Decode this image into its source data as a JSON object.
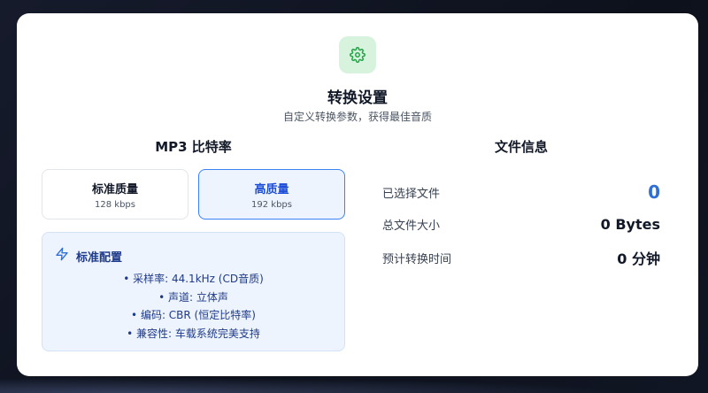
{
  "header": {
    "icon": "gear-icon",
    "title": "转换设置",
    "subtitle": "自定义转换参数，获得最佳音质"
  },
  "bitrate": {
    "heading": "MP3 比特率",
    "options": [
      {
        "label": "标准质量",
        "sub": "128 kbps",
        "selected": false
      },
      {
        "label": "高质量",
        "sub": "192 kbps",
        "selected": true
      }
    ]
  },
  "config": {
    "icon": "lightning-icon",
    "title": "标准配置",
    "items": [
      "• 采样率: 44.1kHz (CD音质)",
      "• 声道: 立体声",
      "• 编码: CBR (恒定比特率)",
      "• 兼容性: 车载系统完美支持"
    ]
  },
  "file_info": {
    "heading": "文件信息",
    "rows": [
      {
        "label": "已选择文件",
        "value": "0"
      },
      {
        "label": "总文件大小",
        "value": "0 Bytes"
      },
      {
        "label": "预计转换时间",
        "value": "0 分钟"
      }
    ]
  },
  "colors": {
    "accent": "#3b82f6",
    "icon_bg": "#d7f3dd",
    "icon_fg": "#22a447",
    "config_bg": "#eef4fd"
  }
}
